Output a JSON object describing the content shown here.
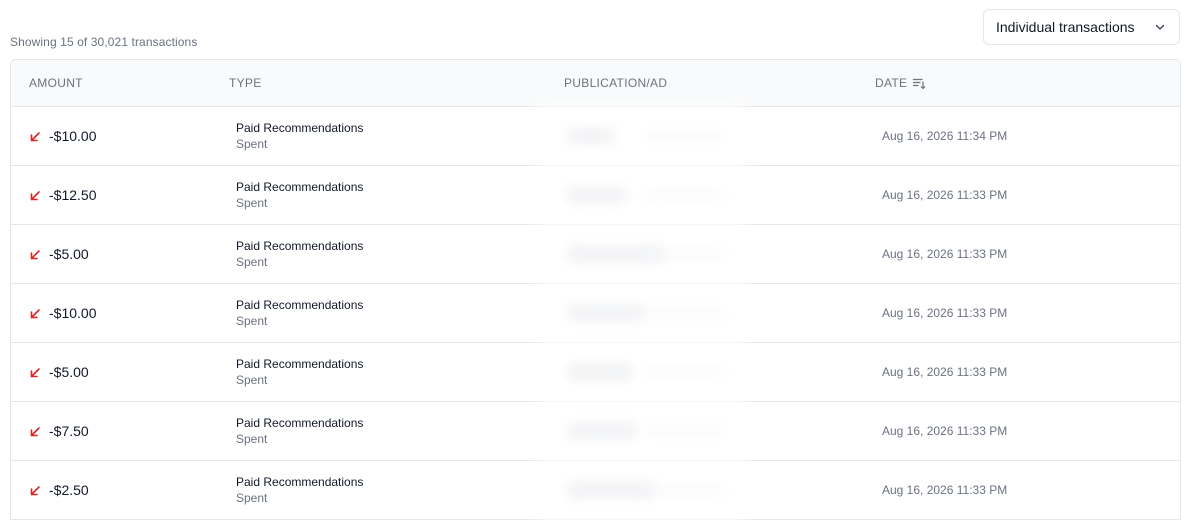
{
  "summary": {
    "showing_text": "Showing 15 of 30,021 transactions"
  },
  "view_select": {
    "selected": "Individual transactions"
  },
  "table": {
    "headers": {
      "amount": "AMOUNT",
      "type": "TYPE",
      "publication": "PUBLICATION/AD",
      "date": "DATE"
    },
    "rows": [
      {
        "amount": "-$10.00",
        "type": "Paid Recommendations",
        "subtype": "Spent",
        "date": "Aug 16, 2026 11:34 PM"
      },
      {
        "amount": "-$12.50",
        "type": "Paid Recommendations",
        "subtype": "Spent",
        "date": "Aug 16, 2026 11:33 PM"
      },
      {
        "amount": "-$5.00",
        "type": "Paid Recommendations",
        "subtype": "Spent",
        "date": "Aug 16, 2026 11:33 PM"
      },
      {
        "amount": "-$10.00",
        "type": "Paid Recommendations",
        "subtype": "Spent",
        "date": "Aug 16, 2026 11:33 PM"
      },
      {
        "amount": "-$5.00",
        "type": "Paid Recommendations",
        "subtype": "Spent",
        "date": "Aug 16, 2026 11:33 PM"
      },
      {
        "amount": "-$7.50",
        "type": "Paid Recommendations",
        "subtype": "Spent",
        "date": "Aug 16, 2026 11:33 PM"
      },
      {
        "amount": "-$2.50",
        "type": "Paid Recommendations",
        "subtype": "Spent",
        "date": "Aug 16, 2026 11:33 PM"
      }
    ]
  },
  "icons": {
    "amount_direction": "arrow-down-left-icon",
    "select_chevron": "chevron-down-icon",
    "date_sort": "sort-descending-icon"
  },
  "colors": {
    "negative_arrow": "#dc2626",
    "header_bg": "#f9fafb",
    "border": "#e5e7eb",
    "muted_text": "#6b7280"
  }
}
